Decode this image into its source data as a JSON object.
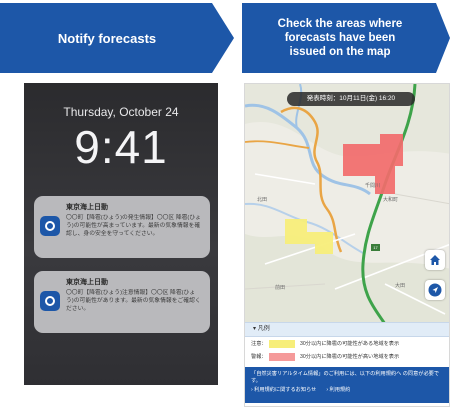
{
  "steps": {
    "step1_label": "Notify forecasts",
    "step2_label": "Check the areas where\nforecasts have been\nissued on the map"
  },
  "lockscreen": {
    "date": "Thursday, October 24",
    "time": "9:41",
    "notifications": [
      {
        "app": "東京海上日動",
        "body": "〇〇町【降雹(ひょう)の発生情報】〇〇区 降雹(ひょう)の可能性が高まっています。最新の気象情報を確認し、身の安全を守ってください。"
      },
      {
        "app": "東京海上日動",
        "body": "〇〇町【降雹(ひょう)注意情報】〇〇区 降雹(ひょう)の可能性があります。最新の気象情報をご確認ください。"
      }
    ]
  },
  "map": {
    "timestamp": "発表時刻：10月11日(金) 16:20",
    "places": [
      "千間川",
      "大和町",
      "北田",
      "前田",
      "大田"
    ],
    "road_number": "17",
    "colors": {
      "warning": "#f26b6b",
      "caution": "#f7ee7a",
      "route": "#3ea34a"
    }
  },
  "legend": {
    "header": "凡例",
    "rows": [
      {
        "label": "注意：",
        "color": "#f7ee7a",
        "text": "30分以内に降雹の可能性がある地域を表示"
      },
      {
        "label": "警報：",
        "color": "#f59a9a",
        "text": "30分以内に降雹の可能性が高い地域を表示"
      }
    ],
    "notice": "「自然災害リアルタイム情報」のご利用には、以下の利用規約へ の同意が必要です。",
    "links": [
      "利用規約に関するお知らせ",
      "利用規約"
    ]
  }
}
